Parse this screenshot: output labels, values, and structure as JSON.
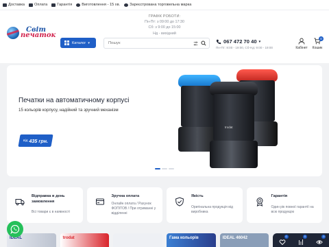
{
  "topbar": {
    "items": [
      {
        "label": "Доставка",
        "icon": "truck-icon"
      },
      {
        "label": "Оплата",
        "icon": "card-icon"
      },
      {
        "label": "Гарантія",
        "icon": "trophy-icon"
      },
      {
        "label": "Виготовлення - 15 хв.",
        "icon": "clock-icon"
      },
      {
        "label": "Зареєстрована торговельна марка",
        "icon": "registered-icon"
      }
    ]
  },
  "schedule": {
    "title": "ГРАФІК РОБОТИ:",
    "lines": [
      "Пн-Пт: з 09:00 до 17:30",
      "Сб: з 9:00 до 15:00",
      "Нд - вихідний"
    ]
  },
  "logo": {
    "line1": "Світ",
    "line2": "печаток"
  },
  "catalog": {
    "label": "Каталог"
  },
  "search": {
    "placeholder": "Пошук"
  },
  "contacts": {
    "phone": "067 472 70 40",
    "hours": "Пн-Пт: 8:00 - 19:00, Сб-Нд: 9:00 - 19:00"
  },
  "account": {
    "cabinet_label": "Кабінет",
    "cart_label": "Кошик",
    "cart_count": "0"
  },
  "hero": {
    "title": "Печатки на автоматичному корпусі",
    "subtitle": "15 кольорів корпусу, надійний та зручний механізм",
    "price_prefix": "від",
    "price": "435 грн.",
    "stamp_brand": "trodat",
    "dots": 3,
    "active_dot": 0
  },
  "features": [
    {
      "icon": "truck-icon",
      "title": "Відправка в день замовлення",
      "text": "Всі товари є в наявності"
    },
    {
      "icon": "card-icon",
      "title": "Зручна оплата",
      "text": "Онлайн оплата / Рахунок ФОП/ТОВ / При отриманні у відділенні"
    },
    {
      "icon": "shield-icon",
      "title": "Якість",
      "text": "Оригінальна продукція від виробника"
    },
    {
      "icon": "medal-icon",
      "title": "Гарантія",
      "text": "Один рік повної гарантії на всю продукцію"
    }
  ],
  "products": [
    {
      "label": "IDEAL"
    },
    {
      "label": "trodat"
    },
    {
      "label": ""
    },
    {
      "label": "Гама кольорів"
    },
    {
      "label": "IDEAL 46042"
    },
    {
      "label": ""
    }
  ],
  "floating": {
    "wishlist_count": "0",
    "compare_count": "0",
    "viewed_count": "0"
  },
  "colors": {
    "accent": "#1f5fc7",
    "logo_red": "#d01f4a",
    "whatsapp": "#25c05a",
    "dark": "#1f2637"
  }
}
